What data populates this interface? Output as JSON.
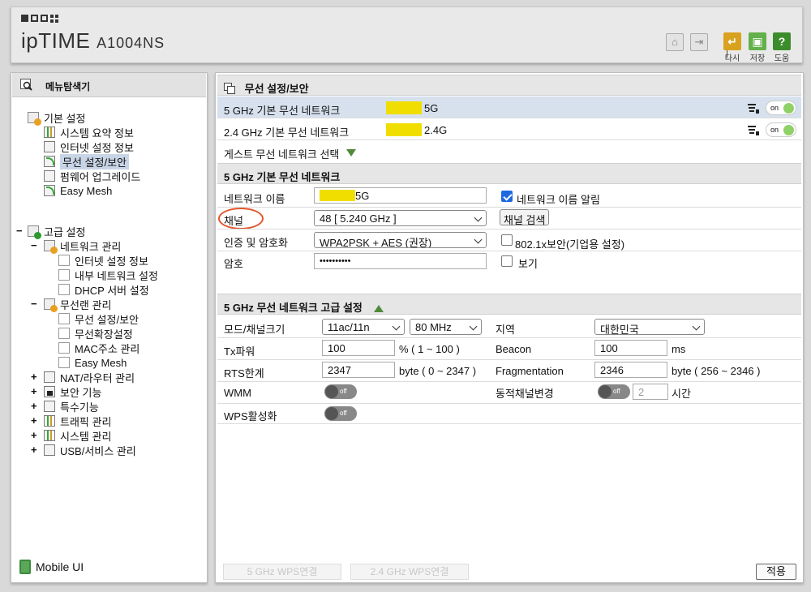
{
  "header": {
    "brand": "ipTIME",
    "model": "A1004NS",
    "buttons": {
      "reload": "다시",
      "save": "저장",
      "help": "도움"
    },
    "colors": {
      "reload": "#d9a21e",
      "save": "#64b04a",
      "help": "#3b8d2c"
    }
  },
  "sidebar": {
    "title": "메뉴탐색기",
    "basic": {
      "label": "기본 설정",
      "items": [
        "시스템 요약 정보",
        "인터넷 설정 정보",
        "무선 설정/보안",
        "펌웨어 업그레이드",
        "Easy Mesh"
      ]
    },
    "advanced": {
      "toggle": "−",
      "label": "고급 설정",
      "network": {
        "label": "네트워크 관리",
        "items": [
          "인터넷 설정 정보",
          "내부 네트워크 설정",
          "DHCP 서버 설정"
        ]
      },
      "wireless": {
        "label": "무선랜 관리",
        "items": [
          "무선 설정/보안",
          "무선확장설정",
          "MAC주소 관리",
          "Easy Mesh"
        ]
      },
      "collapsed": [
        "NAT/라우터 관리",
        "보안 기능",
        "특수기능",
        "트래픽 관리",
        "시스템 관리",
        "USB/서비스 관리"
      ]
    },
    "mobile": "Mobile UI"
  },
  "main": {
    "title": "무선 설정/보안",
    "networks": [
      {
        "name": "5 GHz 기본 무선 네트워크",
        "ssid": "5G",
        "state": "on"
      },
      {
        "name": "2.4 GHz 기본 무선 네트워크",
        "ssid": "2.4G",
        "state": "on"
      }
    ],
    "guest": "게스트 무선 네트워크 선택",
    "basic_section": {
      "title": "5 GHz 기본 무선 네트워크",
      "network_name_label": "네트워크 이름",
      "network_name_value": "5G",
      "broadcast_label": "네트워크 이름 알림",
      "channel_label": "채널",
      "channel_value": "48 [ 5.240 GHz ]",
      "channel_search": "채널 검색",
      "auth_label": "인증 및 암호화",
      "auth_value": "WPA2PSK + AES (권장)",
      "enterprise_label": "802.1x보안(기업용 설정)",
      "password_label": "암호",
      "password_value": "••••••••••",
      "show_label": "보기"
    },
    "advanced_section": {
      "title": "5 GHz 무선 네트워크 고급 설정",
      "mode_label": "모드/채널크기",
      "mode_value": "11ac/11n",
      "width_value": "80 MHz",
      "region_label": "지역",
      "region_value": "대한민국",
      "tx_label": "Tx파워",
      "tx_value": "100",
      "tx_unit": "% ( 1 ~ 100 )",
      "beacon_label": "Beacon",
      "beacon_value": "100",
      "beacon_unit": "ms",
      "rts_label": "RTS한계",
      "rts_value": "2347",
      "rts_unit": "byte ( 0 ~ 2347 )",
      "frag_label": "Fragmentation",
      "frag_value": "2346",
      "frag_unit": "byte ( 256 ~ 2346 )",
      "wmm_label": "WMM",
      "dyn_label": "동적채널변경",
      "dyn_value": "2",
      "dyn_unit": "시간",
      "wps_label": "WPS활성화",
      "off_text": "off",
      "on_text": "on"
    },
    "footer": {
      "wps5": "5 GHz WPS연결",
      "wps24": "2.4 GHz WPS연결",
      "apply": "적용"
    }
  }
}
